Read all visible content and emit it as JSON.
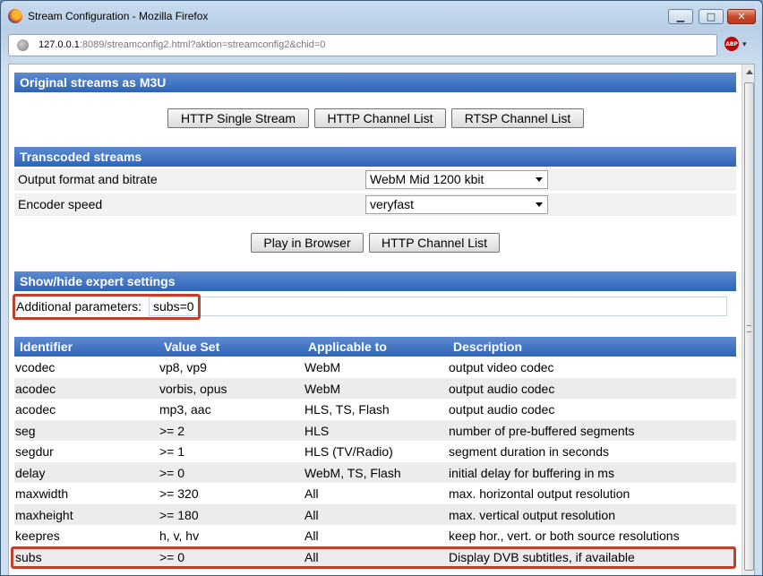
{
  "window": {
    "title": "Stream Configuration - Mozilla Firefox",
    "minimize_glyph": "▁",
    "maximize_glyph": "□",
    "close_glyph": "✕"
  },
  "urlbar": {
    "host": "127.0.0.1",
    "rest": ":8089/streamconfig2.html?aktion=streamconfig2&chid=0"
  },
  "abp": {
    "label": "ABP",
    "arrow": "▾"
  },
  "sections": {
    "original": "Original streams as M3U",
    "transcoded": "Transcoded streams",
    "expert": "Show/hide expert settings"
  },
  "original_buttons": [
    "HTTP Single Stream",
    "HTTP Channel List",
    "RTSP Channel List"
  ],
  "transcoded": {
    "format_label": "Output format and bitrate",
    "format_value": "WebM Mid 1200 kbit",
    "speed_label": "Encoder speed",
    "speed_value": "veryfast",
    "buttons": [
      "Play in Browser",
      "HTTP Channel List"
    ]
  },
  "expert": {
    "param_label": "Additional parameters:",
    "param_value": "subs=0"
  },
  "table": {
    "headers": [
      "Identifier",
      "Value Set",
      "Applicable to",
      "Description"
    ],
    "rows": [
      [
        "vcodec",
        "vp8, vp9",
        "WebM",
        "output video codec"
      ],
      [
        "acodec",
        "vorbis, opus",
        "WebM",
        "output audio codec"
      ],
      [
        "acodec",
        "mp3, aac",
        "HLS, TS, Flash",
        "output audio codec"
      ],
      [
        "seg",
        ">= 2",
        "HLS",
        "number of pre-buffered segments"
      ],
      [
        "segdur",
        ">= 1",
        "HLS (TV/Radio)",
        "segment duration in seconds"
      ],
      [
        "delay",
        ">= 0",
        "WebM, TS, Flash",
        "initial delay for buffering in ms"
      ],
      [
        "maxwidth",
        ">= 320",
        "All",
        "max. horizontal output resolution"
      ],
      [
        "maxheight",
        ">= 180",
        "All",
        "max. vertical output resolution"
      ],
      [
        "keepres",
        "h, v, hv",
        "All",
        "keep hor., vert. or both source resolutions"
      ],
      [
        "subs",
        ">= 0",
        "All",
        "Display DVB subtitles, if available"
      ]
    ]
  },
  "colors": {
    "section_header": "#2e64b7",
    "highlight": "#c0412b"
  }
}
